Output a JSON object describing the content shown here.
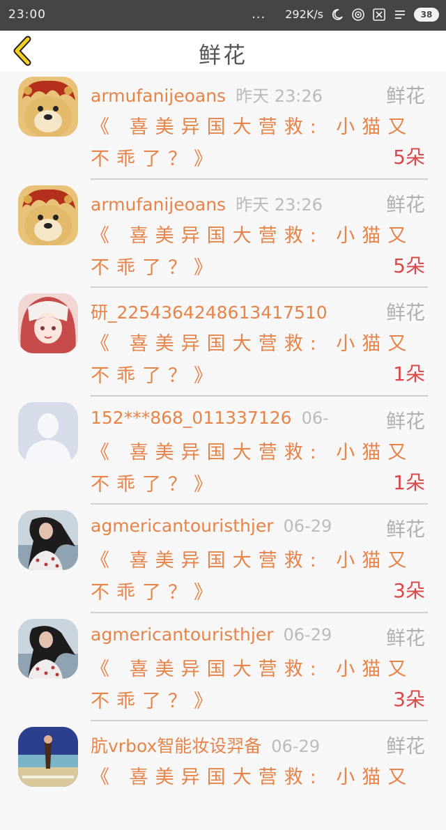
{
  "status_bar": {
    "time": "23:00",
    "dots": "...",
    "speed": "292K/s",
    "battery": "38"
  },
  "header": {
    "title": "鲜花"
  },
  "items": [
    {
      "name": "armufanijeoans",
      "time": "昨天 23:26",
      "label": "鲜花",
      "msg_line1": "《 喜美异国大营救: 小猫又",
      "msg_line2": "不乖了？》",
      "count": "5朵",
      "avatar": "doge-avatar"
    },
    {
      "name": "armufanijeoans",
      "time": "昨天 23:26",
      "label": "鲜花",
      "msg_line1": "《 喜美异国大营救: 小猫又",
      "msg_line2": "不乖了？》",
      "count": "5朵",
      "avatar": "doge-avatar"
    },
    {
      "name": "研_2254364248613417510",
      "time": "",
      "label": "鲜花",
      "msg_line1": "《 喜美异国大营救: 小猫又",
      "msg_line2": "不乖了？》",
      "count": "1朵",
      "avatar": "anime-girl-avatar"
    },
    {
      "name": "152***868_011337126",
      "time": "06-",
      "label": "鲜花",
      "msg_line1": "《 喜美异国大营救: 小猫又",
      "msg_line2": "不乖了？》",
      "count": "1朵",
      "avatar": "default-person-avatar"
    },
    {
      "name": "agmericantouristhjer",
      "time": "06-29",
      "label": "鲜花",
      "msg_line1": "《 喜美异国大营救: 小猫又",
      "msg_line2": "不乖了？》",
      "count": "3朵",
      "avatar": "girl-photo-avatar"
    },
    {
      "name": "agmericantouristhjer",
      "time": "06-29",
      "label": "鲜花",
      "msg_line1": "《 喜美异国大营救: 小猫又",
      "msg_line2": "不乖了？》",
      "count": "3朵",
      "avatar": "girl-photo-avatar"
    },
    {
      "name": "肮vrbox智能妆设羿备",
      "time": "06-29",
      "label": "鲜花",
      "msg_line1": "《 喜美异国大营救: 小猫又",
      "msg_line2": "",
      "count": "",
      "avatar": "poster-avatar"
    }
  ]
}
